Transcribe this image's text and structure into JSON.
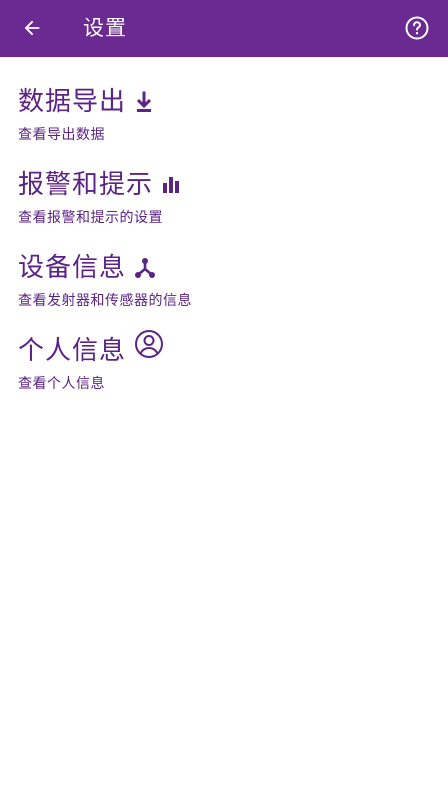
{
  "header": {
    "title": "设置",
    "back_icon": "arrow-left-icon",
    "help_icon": "question-circle-icon"
  },
  "menu": {
    "items": [
      {
        "title": "数据导出",
        "subtitle": "查看导出数据",
        "icon": "download-icon"
      },
      {
        "title": "报警和提示",
        "subtitle": "查看报警和提示的设置",
        "icon": "bar-chart-icon"
      },
      {
        "title": "设备信息",
        "subtitle": "查看发射器和传感器的信息",
        "icon": "device-hub-icon"
      },
      {
        "title": "个人信息",
        "subtitle": "查看个人信息",
        "icon": "account-circle-icon"
      }
    ]
  },
  "colors": {
    "primary": "#6a2a91",
    "text_accent": "#5b2385",
    "background": "#ffffff"
  }
}
